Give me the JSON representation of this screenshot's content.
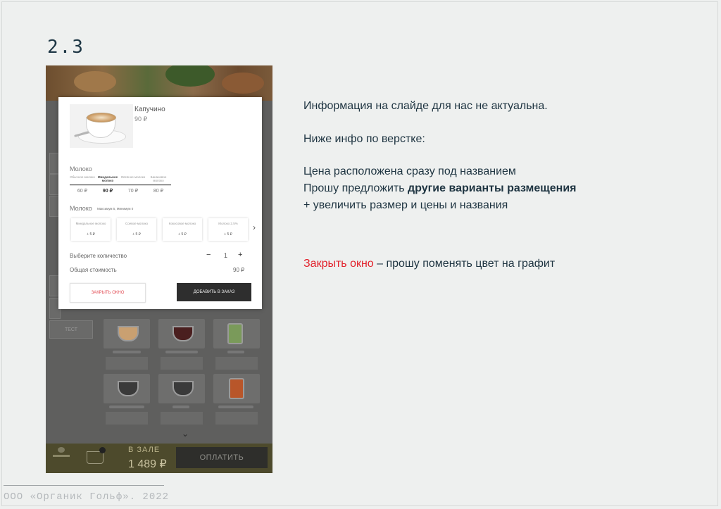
{
  "slide": {
    "number": "2.3",
    "footer": "ООО «Органик Гольф». 2022"
  },
  "notes": {
    "line1": "Информация на слайде для нас не актуальна.",
    "line2": "Ниже инфо по верстке:",
    "line3": "Цена расположена сразу под названием",
    "line4_prefix": "Прошу предложить ",
    "line4_bold": "другие варианты размещения",
    "line5": "+ увеличить размер и цены и названия",
    "line6_red": "Закрыть окно",
    "line6_rest": " – прошу поменять цвет на графит"
  },
  "modal": {
    "product_name": "Капучино",
    "product_price": "90 ₽",
    "milk_heading": "Молоко",
    "milk_options": [
      {
        "name": "Обычное молоко",
        "price": "60 ₽"
      },
      {
        "name": "Миндальное молоко",
        "price": "90 ₽",
        "selected": true
      },
      {
        "name": "Овсяное молоко",
        "price": "70 ₽"
      },
      {
        "name": "Банановое молоко",
        "price": "80 ₽"
      }
    ],
    "extra_heading": "Молоко",
    "extra_sub": "Максимум 5, Минимум 0",
    "extra_options": [
      {
        "name": "Миндальное молоко",
        "price": "+ 5 ₽"
      },
      {
        "name": "Соевое молоко",
        "price": "+ 5 ₽"
      },
      {
        "name": "Кокосовое молоко",
        "price": "+ 5 ₽"
      },
      {
        "name": "Молоко 2.5%",
        "price": "+ 5 ₽"
      }
    ],
    "qty_label": "Выберите количество",
    "qty_minus": "−",
    "qty_value": "1",
    "qty_plus": "+",
    "total_label": "Общая стоимость",
    "total_value": "90 ₽",
    "close_label": "ЗАКРЫТЬ ОКНО",
    "add_label": "ДОБАВИТЬ В ЗАКАЗ"
  },
  "background_app": {
    "side_button": "ТЕСТ",
    "hall_label": "В ЗАЛЕ",
    "hall_sum": "1 489 ₽",
    "pay_label": "ОПЛАТИТЬ"
  },
  "colors": {
    "title": "#1d3644",
    "accent_red": "#e2212b",
    "close_text": "#e24b53",
    "dark_button": "#2e2e2e"
  }
}
